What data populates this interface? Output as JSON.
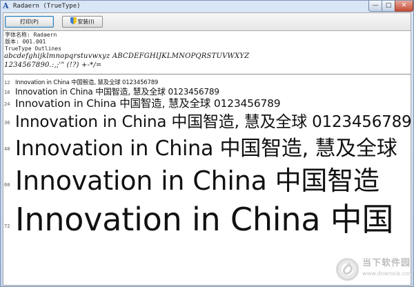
{
  "window": {
    "title": "Radaern (TrueType)",
    "controls": {
      "minimize": "—",
      "maximize": "□",
      "close": "✕"
    }
  },
  "toolbar": {
    "print_label": "打印(P)",
    "install_label": "安装(I)"
  },
  "info": {
    "font_name": "字体名称: Radaern",
    "version": "版本: 001.001",
    "outline": "TrueType Outlines"
  },
  "charset": {
    "line1": "abcdefghijklmnopqrstuvwxyz ABCDEFGHIJKLMNOPQRSTUVWXYZ",
    "line2": "1234567890.:,;'\" (!?) +-*/="
  },
  "samples": [
    {
      "size": "12",
      "text": "Innovation in China 中国智造, 慧及全球 0123456789"
    },
    {
      "size": "18",
      "text": "Innovation in China 中国智造, 慧及全球 0123456789"
    },
    {
      "size": "24",
      "text": "Innovation in China 中国智造, 慧及全球 0123456789"
    },
    {
      "size": "36",
      "text": "Innovation in China 中国智造, 慧及全球 0123456789"
    },
    {
      "size": "48",
      "text": "Innovation in China 中国智造, 慧及全球"
    },
    {
      "size": "60",
      "text": "Innovation in China 中国智造"
    },
    {
      "size": "72",
      "text": "Innovation in China 中国"
    }
  ],
  "watermark": {
    "title": "当下软件园",
    "url": "www.downxia.com"
  },
  "colors": {
    "frame": "#c9daf0",
    "close_button": "#c44d36",
    "print_button_focus": "#3c7fb1"
  }
}
